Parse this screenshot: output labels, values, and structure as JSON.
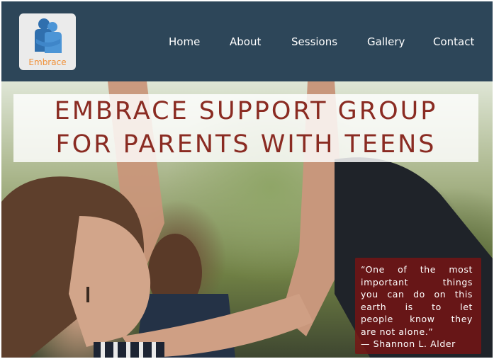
{
  "brand": {
    "logo_text": "Embrace",
    "logo_colors": {
      "figure": "#3f86c9",
      "text": "#f0913a",
      "tile": "#ebebeb"
    }
  },
  "nav": {
    "items": [
      "Home",
      "About",
      "Sessions",
      "Gallery",
      "Contact"
    ]
  },
  "hero": {
    "title_line_1": "EMBRACE SUPPORT GROUP",
    "title_line_2": "FOR PARENTS WITH TEENS",
    "title_color": "#8a2b22",
    "quote_lines": [
      "“One of the most",
      "important things",
      "you can do on this",
      "earth is to let",
      "people know they",
      "are not alone.”"
    ],
    "quote_author": "— Shannon L. Alder"
  },
  "colors": {
    "header_bg": "#2d4659",
    "quote_bg": "#78141499"
  }
}
